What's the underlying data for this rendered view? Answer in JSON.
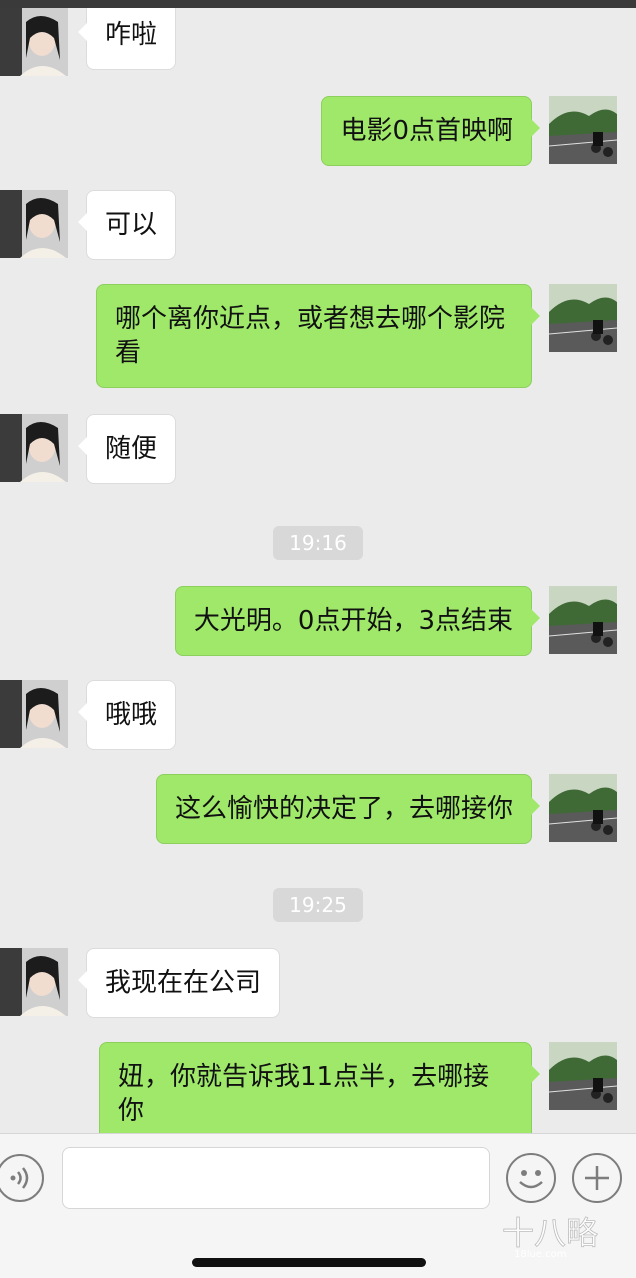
{
  "messages": [
    {
      "side": "in",
      "text": "咋啦"
    },
    {
      "side": "out",
      "text": "电影0点首映啊"
    },
    {
      "side": "in",
      "text": "可以"
    },
    {
      "side": "out",
      "text": "哪个离你近点，或者想去哪个影院看"
    },
    {
      "side": "in",
      "text": "随便"
    },
    {
      "side": "time",
      "text": "19:16"
    },
    {
      "side": "out",
      "text": "大光明。0点开始，3点结束"
    },
    {
      "side": "in",
      "text": "哦哦"
    },
    {
      "side": "out",
      "text": "这么愉快的决定了，去哪接你"
    },
    {
      "side": "time",
      "text": "19:25"
    },
    {
      "side": "in",
      "text": "我现在在公司"
    },
    {
      "side": "out",
      "text": "妞，你就告诉我11点半，去哪接你"
    }
  ],
  "input_bar": {
    "placeholder": "",
    "voice_icon": "voice-icon",
    "emoji_icon": "smiley-icon",
    "plus_icon": "plus-icon"
  },
  "watermark": {
    "brand": "十八略",
    "domain": "18lue.com"
  },
  "colors": {
    "background": "#ebebeb",
    "outgoing_bubble": "#9fe86a",
    "incoming_bubble": "#ffffff",
    "time_badge": "#d8d8d8"
  }
}
